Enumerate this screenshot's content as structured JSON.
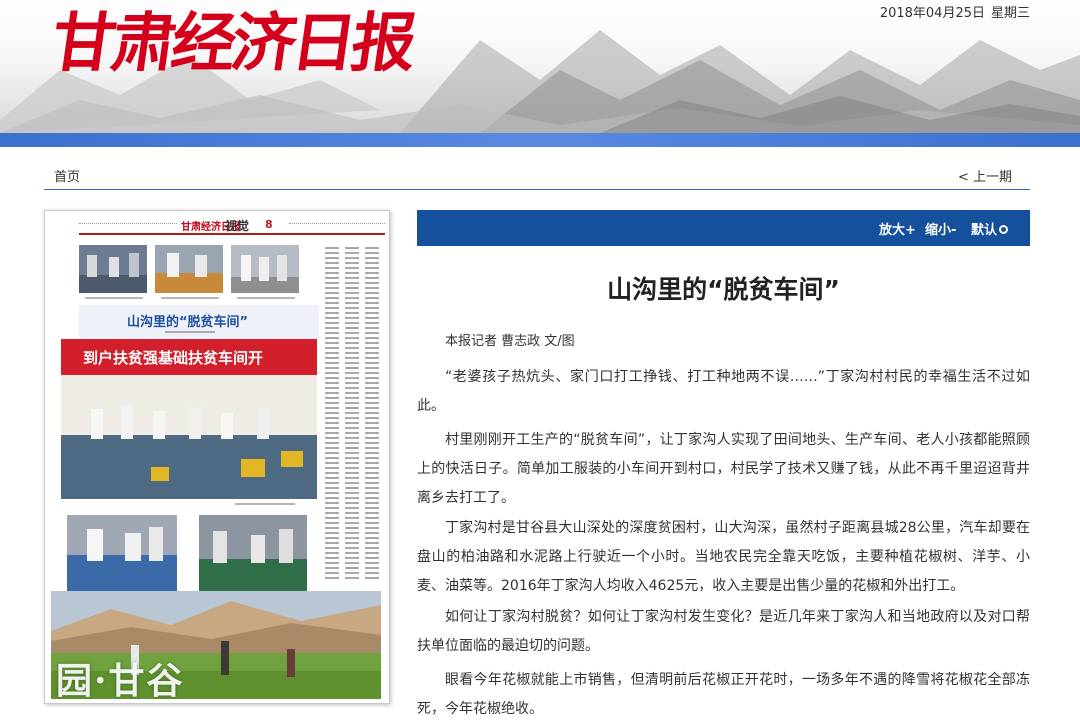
{
  "header": {
    "logo_text": "甘肃经济日报",
    "date": "2018年04月25日",
    "weekday": "星期三"
  },
  "nav": {
    "home": "首页",
    "prev_issue": "< 上一期"
  },
  "paper_thumb": {
    "section": "视觉",
    "page_number": "8",
    "headline": "山沟里的“脱贫车间”",
    "banner_text": "到户扶贫强基础扶贫车间开",
    "watermark": "园·甘谷"
  },
  "toolbar": {
    "zoom_in": "放大+",
    "zoom_out": "缩小-",
    "default": "默认"
  },
  "article": {
    "title": "山沟里的“脱贫车间”",
    "byline": "本报记者 曹志政 文/图",
    "paragraphs": [
      "“老婆孩子热炕头、家门口打工挣钱、打工种地两不误……”丁家沟村村民的幸福生活不过如此。",
      "村里刚刚开工生产的“脱贫车间”，让丁家沟人实现了田间地头、生产车间、老人小孩都能照顾上的快活日子。简单加工服装的小车间开到村口，村民学了技术又赚了钱，从此不再千里迢迢背井离乡去打工了。",
      "丁家沟村是甘谷县大山深处的深度贫困村，山大沟深，虽然村子距离县城28公里，汽车却要在盘山的柏油路和水泥路上行驶近一个小时。当地农民完全靠天吃饭，主要种植花椒树、洋芋、小麦、油菜等。2016年丁家沟人均收入4625元，收入主要是出售少量的花椒和外出打工。",
      "如何让丁家沟村脱贫？如何让丁家沟村发生变化？是近几年来丁家沟人和当地政府以及对口帮扶单位面临的最迫切的问题。",
      "眼看今年花椒就能上市销售，但清明前后花椒正开花时，一场多年不遇的降雪将花椒花全部冻死，今年花椒绝收。"
    ]
  },
  "colors": {
    "brand_red": "#d4001b",
    "toolbar_blue": "#14509c",
    "nav_line": "#3a68b8"
  }
}
